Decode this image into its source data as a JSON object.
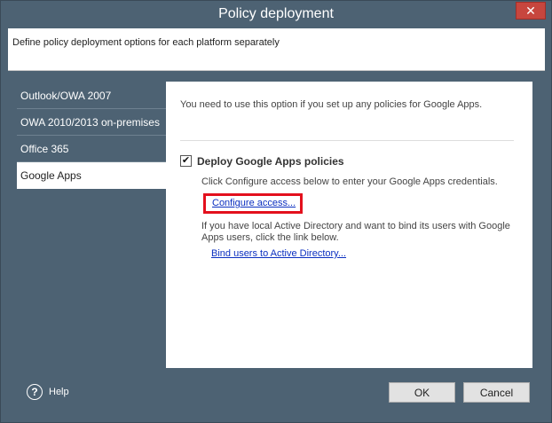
{
  "window": {
    "title": "Policy deployment",
    "close_glyph": "✕"
  },
  "header": {
    "description": "Define policy deployment options for each platform separately"
  },
  "sidebar": {
    "items": [
      {
        "label": "Outlook/OWA 2007"
      },
      {
        "label": "OWA 2010/2013 on-premises"
      },
      {
        "label": "Office 365"
      },
      {
        "label": "Google Apps",
        "selected": true
      }
    ]
  },
  "content": {
    "info": "You need to use this option if you set up any policies for Google Apps.",
    "deploy_checkbox": {
      "checked": true,
      "glyph": "✔",
      "label": "Deploy Google Apps policies"
    },
    "configure_hint": "Click Configure access below to enter your Google Apps credentials.",
    "configure_link": "Configure access...",
    "ad_hint": "If you have local Active Directory and want to bind its users with Google Apps users, click the link below.",
    "bind_link": "Bind users to Active Directory..."
  },
  "footer": {
    "help_icon_glyph": "?",
    "help_label": "Help",
    "ok_label": "OK",
    "cancel_label": "Cancel"
  },
  "colors": {
    "window_bg": "#4d6273",
    "close_button": "#c7463e",
    "highlight_border": "#e3101d",
    "link": "#0b2fc0"
  }
}
